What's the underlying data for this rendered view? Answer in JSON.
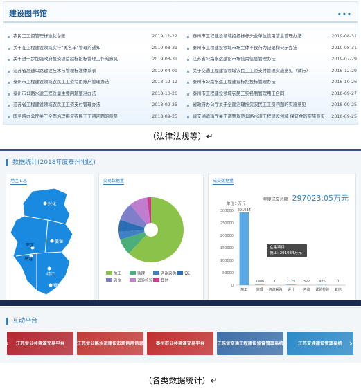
{
  "library": {
    "title": "建设图书馆",
    "more": "...",
    "left_items": [
      {
        "title": "农民工工资管理标准化台账",
        "date": "2019-11-22"
      },
      {
        "title": "关于在工程建设领域实行“黑名单”管理的通知",
        "date": "2019-08-31"
      },
      {
        "title": "关于进一步加强政府投资项目招标投标管理工作的意见",
        "date": "2019-08-31"
      },
      {
        "title": "江苏省高速公路建设技术与管理标准体系表",
        "date": "2019-04-09"
      },
      {
        "title": "泰州市工程建设领域农民工工资专用账户管理办法",
        "date": "2018-12-12"
      },
      {
        "title": "泰州市公路水运工程质量主要问题整治办法",
        "date": "2018-10-26"
      },
      {
        "title": "江苏省工程建设领域农民工工资支付管理办法",
        "date": "2018-09-25"
      },
      {
        "title": "国务院办公厅关于全面治理拖欠农民工工资问题的意见",
        "date": "2018-09-25"
      }
    ],
    "right_items": [
      {
        "title": "泰州市工程建设领域招投标标头业单位信用信息管理办法",
        "date": "2019-08-31"
      },
      {
        "title": "泰州市工程建设领域市场主体不良行为记录和公示办法",
        "date": "2019-08-31"
      },
      {
        "title": "江苏省公路水运建设市场信用信息管理办法",
        "date": "2019-07-29"
      },
      {
        "title": "关于交通工程建设领域农民工工资支付管理实施意见（试行）",
        "date": "2018-12-29"
      },
      {
        "title": "泰州市公路水运工程建设标招投标管理办法",
        "date": "2018-10-26"
      },
      {
        "title": "泰州市工程建设领域农民工实名制管理用工合同",
        "date": "2018-09-27"
      },
      {
        "title": "省政府办公厅关于全面治理拖欠农民工工资问题的实施意见",
        "date": "2018-09-25"
      },
      {
        "title": "省交通运输厅关于调整规范公路水运工程建设领域 保证金的实施意见",
        "date": "2018-09-25"
      }
    ]
  },
  "captions": {
    "first": "（法律法规等）↵",
    "second": "（各类数据统计）↵"
  },
  "stats": {
    "title": "数据统计(2018年度泰州地区)",
    "map_tab": "地区汇总",
    "pie_tab": "交易数据量",
    "bar_tab": "成交数据量",
    "map_labels": [
      "兴化",
      "姜堰",
      "市区",
      "高港",
      "靖江",
      "泰兴"
    ],
    "pie_legend": [
      "施工",
      "监理",
      "咨询采购",
      "设计",
      "咨询",
      "试验检验",
      "其他"
    ],
    "total_label": "年度成交总额",
    "total_value": "297023.05万元",
    "tooltip_title": "在建项目",
    "tooltip_value": "施工: 291934万元"
  },
  "chart_data": [
    {
      "type": "pie",
      "title": "交易数据量",
      "labels": [
        "施工",
        "监理",
        "咨询采购",
        "设计",
        "咨询",
        "试验检验",
        "其他"
      ],
      "values": [
        62,
        8,
        4,
        6,
        9,
        9,
        2
      ],
      "colors": [
        "#8bc34a",
        "#4caf7a",
        "#3f7fc4",
        "#2a6db5",
        "#7e7fc8",
        "#c07ccf",
        "#d23a8e"
      ]
    },
    {
      "type": "bar",
      "title": "成交数据量",
      "ylabel": "单位：万元",
      "categories": [
        "施工",
        "监理",
        "咨询采购",
        "设计",
        "咨询",
        "试验检验",
        "其他"
      ],
      "values": [
        291934,
        1986,
        0,
        2175,
        322,
        925,
        0
      ],
      "value_labels": [
        "291934",
        "1986",
        "0",
        "2175",
        "322",
        "925",
        "0"
      ],
      "yticks": [
        "300000",
        "250000",
        "200000",
        "150000",
        "100000",
        "50000",
        "0"
      ],
      "ylim": [
        0,
        300000
      ],
      "color": "#5aa9e6"
    }
  ],
  "interactive": {
    "title": "互动平台",
    "prev": "‹",
    "next": "›",
    "banners": [
      {
        "label": "江苏省公共资源交易平台",
        "color": "#b3262f"
      },
      {
        "label": "江苏省公路水运建设市场信用信息服务系统",
        "color": "#c23a36"
      },
      {
        "label": "泰州市公共资源交易平台",
        "color": "#c12e2e"
      },
      {
        "label": "江苏省交通工程建设监督管理系统",
        "color": "#3d6fa8"
      },
      {
        "label": "江苏交通建设管理系统",
        "color": "#2b8ac7"
      }
    ]
  }
}
